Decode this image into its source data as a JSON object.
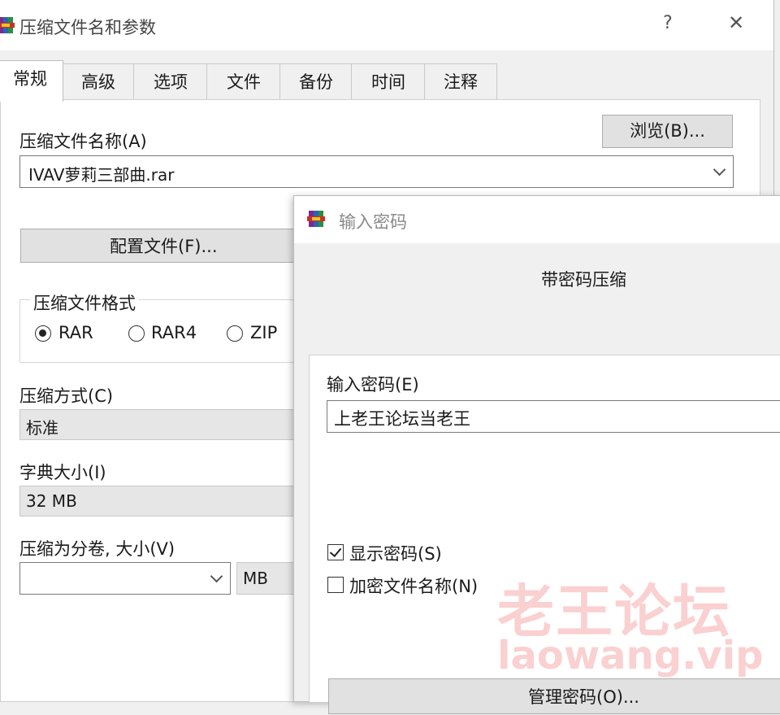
{
  "main": {
    "title": "压缩文件名和参数",
    "help_glyph": "?",
    "close_glyph": "✕",
    "tabs": [
      {
        "label": "常规"
      },
      {
        "label": "高级"
      },
      {
        "label": "选项"
      },
      {
        "label": "文件"
      },
      {
        "label": "备份"
      },
      {
        "label": "时间"
      },
      {
        "label": "注释"
      }
    ],
    "archive_name_label": "压缩文件名称(A)",
    "browse_label": "浏览(B)...",
    "archive_name_value": "IVAV萝莉三部曲.rar",
    "profiles_label": "配置文件(F)...",
    "format_group_label": "压缩文件格式",
    "formats": [
      {
        "label": "RAR",
        "selected": true
      },
      {
        "label": "RAR4",
        "selected": false
      },
      {
        "label": "ZIP",
        "selected": false
      }
    ],
    "method_label": "压缩方式(C)",
    "method_value": "标准",
    "dict_label": "字典大小(I)",
    "dict_value": "32 MB",
    "split_label": "压缩为分卷, 大小(V)",
    "split_value": "",
    "split_unit": "MB"
  },
  "password_dialog": {
    "title": "输入密码",
    "heading": "带密码压缩",
    "enter_password_label": "输入密码(E)",
    "password_value": "上老王论坛当老王",
    "show_password_label": "显示密码(S)",
    "show_password_checked": true,
    "encrypt_names_label": "加密文件名称(N)",
    "encrypt_names_checked": false,
    "organize_label": "管理密码(O)..."
  },
  "watermark": {
    "text_cn": "老王论坛",
    "text_url": "laowang.vip"
  }
}
